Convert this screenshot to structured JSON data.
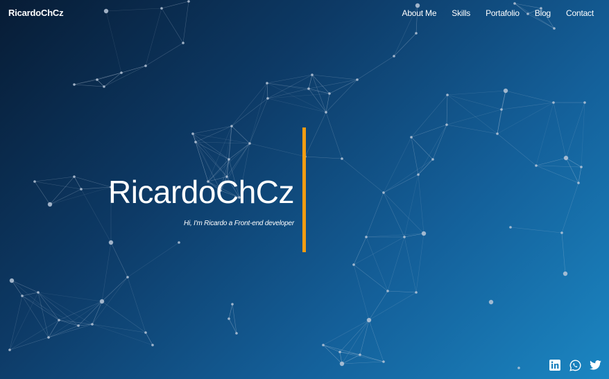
{
  "navbar": {
    "brand": "RicardoChCz",
    "links": [
      {
        "label": "About Me"
      },
      {
        "label": "Skills"
      },
      {
        "label": "Portafolio"
      },
      {
        "label": "Blog"
      },
      {
        "label": "Contact"
      }
    ]
  },
  "hero": {
    "title": "RicardoChCz",
    "subtitle": "Hi, I'm Ricardo a Front-end developer"
  },
  "colors": {
    "accent": "#f39c12",
    "background_dark": "#071c35",
    "background_light": "#1b86c2"
  },
  "social": [
    {
      "icon": "linkedin-icon"
    },
    {
      "icon": "whatsapp-icon"
    },
    {
      "icon": "twitter-icon"
    }
  ]
}
